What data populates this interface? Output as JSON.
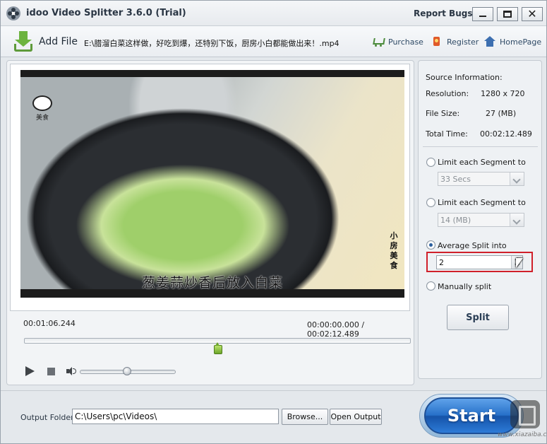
{
  "window": {
    "title": "idoo Video Splitter 3.6.0 (Trial)",
    "report_bugs": "Report Bugs"
  },
  "toolbar": {
    "add_file_label": "Add File",
    "file_path": "E:\\腊溜白菜这样做，好吃到爆，还特别下饭，厨房小白都能做出来！.mp4",
    "purchase_label": "Purchase",
    "register_label": "Register",
    "homepage_label": "HomePage"
  },
  "video": {
    "subtitle": "葱姜蒜炒香后放入白菜",
    "logo_text": "美食",
    "side_text": "小房美食",
    "current_time": "00:01:06.244",
    "range_time": "00:00:00.000 / 00:02:12.489",
    "seek_position_fraction": 0.5,
    "volume_fraction": 0.49
  },
  "source_info": {
    "header": "Source Information:",
    "resolution_label": "Resolution:",
    "resolution_value": "1280 x 720",
    "file_size_label": "File Size:",
    "file_size_value": "27 (MB)",
    "total_time_label": "Total Time:",
    "total_time_value": "00:02:12.489"
  },
  "split_options": {
    "option_time_label": "Limit each Segment to",
    "option_time_value": "33 Secs",
    "option_size_label": "Limit each Segment to",
    "option_size_value": "14 (MB)",
    "option_average_label": "Average Split into",
    "option_average_value": "2",
    "option_manual_label": "Manually split",
    "selected": "average",
    "split_button": "Split"
  },
  "output": {
    "folder_label": "Output Folder:",
    "folder_value": "C:\\Users\\pc\\Videos\\",
    "browse_button": "Browse...",
    "open_output_button": "Open Output",
    "start_button": "Start"
  },
  "watermark": {
    "text": "www.xiazaiba.com"
  },
  "colors": {
    "accent_blue": "#2771c9",
    "highlight_red": "#d0202a",
    "seek_green": "#6ca52a"
  }
}
